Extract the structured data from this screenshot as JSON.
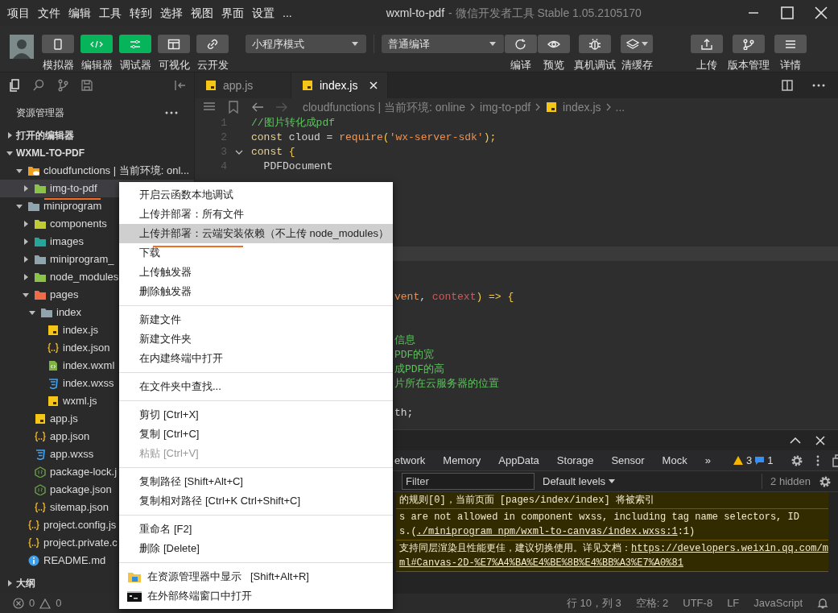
{
  "window": {
    "menus": [
      "项目",
      "文件",
      "编辑",
      "工具",
      "转到",
      "选择",
      "视图",
      "界面",
      "设置",
      "..."
    ],
    "title": "wxml-to-pdf",
    "subtitle": "- 微信开发者工具 Stable 1.05.2105170"
  },
  "toolbar": {
    "view_buttons": [
      {
        "label": "模拟器",
        "active": false
      },
      {
        "label": "编辑器",
        "active": true
      },
      {
        "label": "调试器",
        "active": true
      },
      {
        "label": "可视化",
        "active": false
      },
      {
        "label": "云开发",
        "active": false
      }
    ],
    "mode_select": "小程序模式",
    "compile_select": "普通编译",
    "actions": [
      {
        "label": "编译"
      },
      {
        "label": "预览"
      },
      {
        "label": "真机调试"
      },
      {
        "label": "清缓存"
      }
    ],
    "right_actions": [
      {
        "label": "上传"
      },
      {
        "label": "版本管理"
      },
      {
        "label": "详情"
      }
    ]
  },
  "sidebar": {
    "title": "资源管理器",
    "sections": [
      {
        "label": "打开的编辑器",
        "expanded": false
      },
      {
        "label": "WXML-TO-PDF",
        "expanded": true
      }
    ],
    "tree": [
      {
        "label": "cloudfunctions | 当前环境: onl...",
        "kind": "cloud-folder",
        "color": "#f0a020",
        "expanded": true,
        "selected": false,
        "children": [
          {
            "label": "img-to-pdf",
            "kind": "folder",
            "color": "#8bc34a",
            "expanded": false,
            "selected": true,
            "underlined": true
          }
        ]
      },
      {
        "label": "miniprogram",
        "kind": "folder",
        "color": "#90a4ae",
        "expanded": true,
        "selected": false,
        "children": [
          {
            "label": "components",
            "kind": "folder",
            "color": "#c0ca33",
            "expanded": false,
            "selected": false
          },
          {
            "label": "images",
            "kind": "folder",
            "color": "#26a69a",
            "expanded": false,
            "selected": false
          },
          {
            "label": "miniprogram_",
            "kind": "folder",
            "color": "#90a4ae",
            "expanded": false,
            "selected": false
          },
          {
            "label": "node_modules",
            "kind": "folder",
            "color": "#8bc34a",
            "expanded": false,
            "selected": false
          },
          {
            "label": "pages",
            "kind": "folder",
            "color": "#ef6c4a",
            "expanded": true,
            "selected": false,
            "children": [
              {
                "label": "index",
                "kind": "folder",
                "color": "#90a4ae",
                "expanded": true,
                "selected": false,
                "children": [
                  {
                    "label": "index.js",
                    "kind": "js",
                    "selected": false
                  },
                  {
                    "label": "index.json",
                    "kind": "json",
                    "selected": false
                  },
                  {
                    "label": "index.wxml",
                    "kind": "wxml",
                    "selected": false
                  },
                  {
                    "label": "index.wxss",
                    "kind": "wxss",
                    "selected": false
                  },
                  {
                    "label": "wxml.js",
                    "kind": "js",
                    "selected": false
                  }
                ]
              }
            ]
          },
          {
            "label": "app.js",
            "kind": "js",
            "selected": false
          },
          {
            "label": "app.json",
            "kind": "json",
            "selected": false
          },
          {
            "label": "app.wxss",
            "kind": "wxss",
            "selected": false
          },
          {
            "label": "package-lock.j",
            "kind": "node",
            "selected": false
          },
          {
            "label": "package.json",
            "kind": "node",
            "selected": false
          },
          {
            "label": "sitemap.json",
            "kind": "json",
            "selected": false
          }
        ]
      },
      {
        "label": "project.config.js",
        "kind": "json",
        "selected": false
      },
      {
        "label": "project.private.c",
        "kind": "json",
        "selected": false
      },
      {
        "label": "README.md",
        "kind": "info",
        "selected": false
      }
    ],
    "outline": {
      "label": "大纲",
      "expanded": false
    }
  },
  "editor": {
    "tabs": [
      {
        "label": "app.js",
        "selected": false
      },
      {
        "label": "index.js",
        "selected": true
      }
    ],
    "breadcrumb": [
      {
        "label": "cloudfunctions | 当前环境: online"
      },
      {
        "label": "img-to-pdf"
      },
      {
        "label": "index.js",
        "kind": "js"
      },
      {
        "label": "..."
      }
    ],
    "lines": [
      {
        "number": "1",
        "current": false,
        "tokens": [
          {
            "t": "//图片转化成pdf",
            "kind": "comment"
          }
        ]
      },
      {
        "number": "2",
        "current": false,
        "tokens": [
          {
            "t": "const ",
            "kind": "keyword"
          },
          {
            "t": "cloud = ",
            "kind": "plain"
          },
          {
            "t": "require",
            "kind": "func"
          },
          {
            "t": "(",
            "kind": "punct"
          },
          {
            "t": "'wx-server-sdk'",
            "kind": "string"
          },
          {
            "t": ");",
            "kind": "punct"
          }
        ]
      },
      {
        "number": "3",
        "current": false,
        "folded": false,
        "tokens": [
          {
            "t": "const ",
            "kind": "keyword"
          },
          {
            "t": "{",
            "kind": "punct"
          }
        ]
      },
      {
        "number": "4",
        "current": false,
        "tokens": [
          {
            "t": "  PDFDocument",
            "kind": "plain"
          }
        ]
      },
      {
        "current": false
      },
      {
        "current": false
      },
      {
        "current": false
      },
      {
        "current": false
      },
      {
        "current": false
      },
      {
        "current": true
      },
      {
        "current": false
      },
      {
        "current": false
      },
      {
        "current": false,
        "tokens": [
          {
            "t": "vent",
            "kind": "param"
          },
          {
            "t": ", ",
            "kind": "plain"
          },
          {
            "t": "context",
            "kind": "param2"
          },
          {
            "t": ") => {",
            "kind": "punct"
          }
        ]
      },
      {
        "current": false
      },
      {
        "current": false
      },
      {
        "current": false,
        "tokens": [
          {
            "t": "信息",
            "kind": "comment"
          }
        ]
      },
      {
        "current": false,
        "tokens": [
          {
            "t": "PDF的宽",
            "kind": "comment"
          }
        ]
      },
      {
        "current": false,
        "tokens": [
          {
            "t": "成PDF的高",
            "kind": "comment"
          }
        ]
      },
      {
        "current": false,
        "tokens": [
          {
            "t": "片所在云服务器的位置",
            "kind": "comment"
          }
        ]
      },
      {
        "current": false
      },
      {
        "current": false,
        "tokens": [
          {
            "t": "th;",
            "kind": "plain"
          }
        ]
      }
    ]
  },
  "devtools": {
    "tabs": [
      "etwork",
      "Memory",
      "AppData",
      "Storage",
      "Sensor",
      "Mock"
    ],
    "more": "»",
    "warnings": "3",
    "infos": "1",
    "filter_placeholder": "Filter",
    "levels": "Default levels",
    "hidden": "2 hidden",
    "messages": [
      {
        "lines": [
          [
            {
              "text": "的规则[0]，当前页面 [pages/index/index] 将被索引"
            }
          ]
        ]
      },
      {
        "lines": [
          [
            {
              "text": "s are not allowed in component wxss, including tag name selectors, ID"
            }
          ],
          [
            {
              "text": "s.("
            },
            {
              "text": "./miniprogram_npm/wxml-to-canvas/index.wxss:1",
              "link": true
            },
            {
              "text": ":1)"
            }
          ]
        ]
      },
      {
        "lines": [
          [
            {
              "text": "支持同层渲染且性能更佳，建议切换使用。详见文档："
            },
            {
              "text": "https://developers.weixin.qq.com/m",
              "link": true
            }
          ],
          [
            {
              "text": "ml#Canvas-2D-%E7%A4%BA%E4%BE%8B%E4%BB%A3%E7%A0%81",
              "link": true
            }
          ]
        ]
      }
    ]
  },
  "status_bar": {
    "errors": "0",
    "warnings": "0",
    "items": [
      "行 10，列 3",
      "空格: 2",
      "UTF-8",
      "LF",
      "JavaScript"
    ]
  },
  "context_menu": {
    "groups": [
      [
        {
          "label": "开启云函数本地调试",
          "selected": false,
          "disabled": false
        },
        {
          "label": "上传并部署：所有文件",
          "selected": false,
          "disabled": false
        },
        {
          "label": "上传并部署：云端安装依赖（不上传 node_modules）",
          "selected": true,
          "disabled": false,
          "underlined": true
        },
        {
          "label": "下载",
          "selected": false,
          "disabled": false
        },
        {
          "label": "上传触发器",
          "selected": false,
          "disabled": false
        },
        {
          "label": "删除触发器",
          "selected": false,
          "disabled": false
        }
      ],
      [
        {
          "label": "新建文件",
          "selected": false,
          "disabled": false
        },
        {
          "label": "新建文件夹",
          "selected": false,
          "disabled": false
        },
        {
          "label": "在内建终端中打开",
          "selected": false,
          "disabled": false
        }
      ],
      [
        {
          "label": "在文件夹中查找...",
          "selected": false,
          "disabled": false
        }
      ],
      [
        {
          "label": "剪切",
          "shortcut": "[Ctrl+X]",
          "selected": false,
          "disabled": false
        },
        {
          "label": "复制",
          "shortcut": "[Ctrl+C]",
          "selected": false,
          "disabled": false
        },
        {
          "label": "粘贴",
          "shortcut": "[Ctrl+V]",
          "selected": false,
          "disabled": true
        }
      ],
      [
        {
          "label": "复制路径",
          "shortcut": "[Shift+Alt+C]",
          "selected": false,
          "disabled": false
        },
        {
          "label": "复制相对路径",
          "shortcut": "[Ctrl+K Ctrl+Shift+C]",
          "selected": false,
          "disabled": false
        }
      ],
      [
        {
          "label": "重命名",
          "shortcut": "[F2]",
          "selected": false,
          "disabled": false
        },
        {
          "label": "删除",
          "shortcut": "[Delete]",
          "selected": false,
          "disabled": false
        }
      ],
      [
        {
          "label": "在资源管理器中显示",
          "shortcut": "[Shift+Alt+R]",
          "kind": "explorer",
          "selected": false,
          "disabled": false
        },
        {
          "label": "在外部终端窗口中打开",
          "kind": "terminal",
          "selected": false,
          "disabled": false
        }
      ]
    ]
  }
}
